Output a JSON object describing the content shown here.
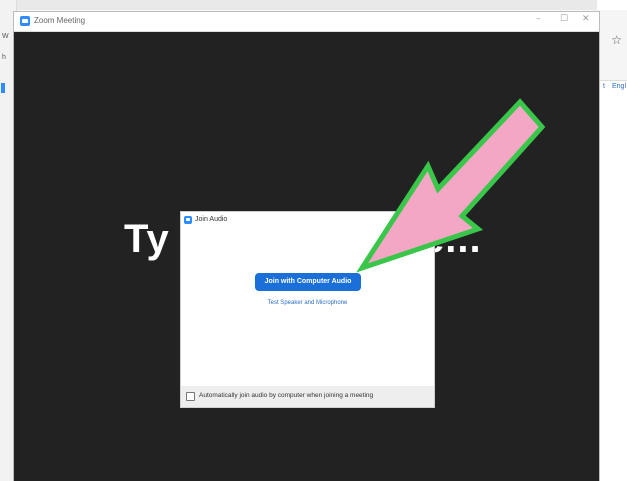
{
  "browser": {
    "left_chars": [
      "W",
      "h"
    ],
    "right_labels": [
      "t",
      "Engl"
    ],
    "star_icon": "star-icon"
  },
  "zoom_window": {
    "title": "Zoom Meeting",
    "minimize_label": "–",
    "maximize_label": "☐",
    "close_label": "✕",
    "background_text_left": "Ty",
    "background_text_right": "e..."
  },
  "dialog": {
    "title": "Join Audio",
    "join_button_label": "Join with Computer Audio",
    "test_link_label": "Test Speaker and Microphone",
    "auto_join_label": "Automatically join audio by computer when joining a meeting",
    "auto_join_checked": false
  },
  "annotation": {
    "arrow_fill": "#f4a7c4",
    "arrow_stroke": "#39c64a"
  },
  "colors": {
    "accent": "#1a6fd8",
    "zoom_blue": "#2d8cff",
    "meeting_bg": "#222222"
  }
}
